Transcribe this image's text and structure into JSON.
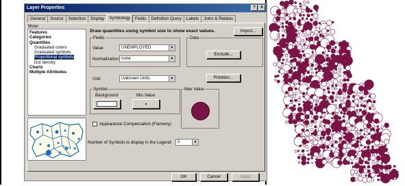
{
  "dialog": {
    "title": "Layer Properties",
    "title_buttons": [
      "?",
      "X"
    ],
    "tabs": [
      "General",
      "Source",
      "Selection",
      "Display",
      "Symbology",
      "Fields",
      "Definition Query",
      "Labels",
      "Joins & Relates"
    ],
    "active_tab": "Symbology"
  },
  "show": {
    "label": "Show:",
    "items": [
      {
        "label": "Features",
        "kind": "category"
      },
      {
        "label": "Categories",
        "kind": "category"
      },
      {
        "label": "Quantities",
        "kind": "category"
      },
      {
        "label": "Graduated colors",
        "kind": "sub"
      },
      {
        "label": "Graduated symbols",
        "kind": "sub"
      },
      {
        "label": "Proportional symbols",
        "kind": "sub",
        "selected": true
      },
      {
        "label": "Dot density",
        "kind": "sub"
      },
      {
        "label": "Charts",
        "kind": "category"
      },
      {
        "label": "Multiple Attributes",
        "kind": "category"
      }
    ]
  },
  "symbology": {
    "heading": "Draw quantities using symbol size to show exact values.",
    "import_label": "Import...",
    "fields_label": "Fields",
    "value_label": "Value:",
    "value_selected": "UNEMPLOYED",
    "normalization_label": "Normalization:",
    "normalization_selected": "none",
    "data_label": "Data",
    "exclude_label": "Exclude...",
    "unit_label": "Unit:",
    "unit_selected": "Unknown Units",
    "rotation_label": "Rotation...",
    "symbol_label": "Symbol",
    "background_label": "Background",
    "min_value_label": "Min Value",
    "max_value_label": "Max Value",
    "appearance_label": "Appearance Compensation (Flannery)",
    "num_symbols_label": "Number of Symbols to display in the Legend:",
    "num_symbols_value": "5"
  },
  "footer": {
    "ok": "OK",
    "cancel": "Cancel",
    "apply": "Apply"
  },
  "colors": {
    "symbol": "#7a1446",
    "map_fill": "#7a1446",
    "selection": "#0a246a"
  }
}
